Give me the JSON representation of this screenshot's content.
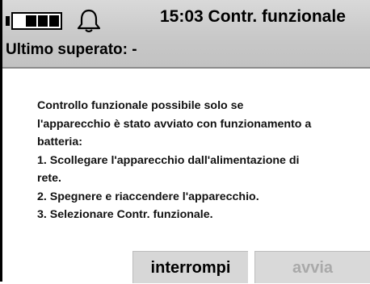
{
  "status_bar": {
    "battery_icon": "battery-icon",
    "battery_level": 0.75,
    "bell_icon": "bell-icon",
    "title": "15:03 Contr. funzionale"
  },
  "subtitle": "Ultimo superato: -",
  "message": {
    "lines": [
      "Controllo funzionale possibile solo se",
      "l'apparecchio è stato avviato con funzionamento a",
      "batteria:",
      "1. Scollegare l'apparecchio dall'alimentazione di",
      "rete.",
      "2. Spegnere e riaccendere l'apparecchio.",
      "3. Selezionare Contr. funzionale."
    ]
  },
  "buttons": {
    "cancel_label": "interrompi",
    "start_label": "avvia"
  },
  "colors": {
    "header_bg": "#c8c8c8",
    "button_bg": "#d7d7d7",
    "disabled_text": "#a9a9a9"
  }
}
